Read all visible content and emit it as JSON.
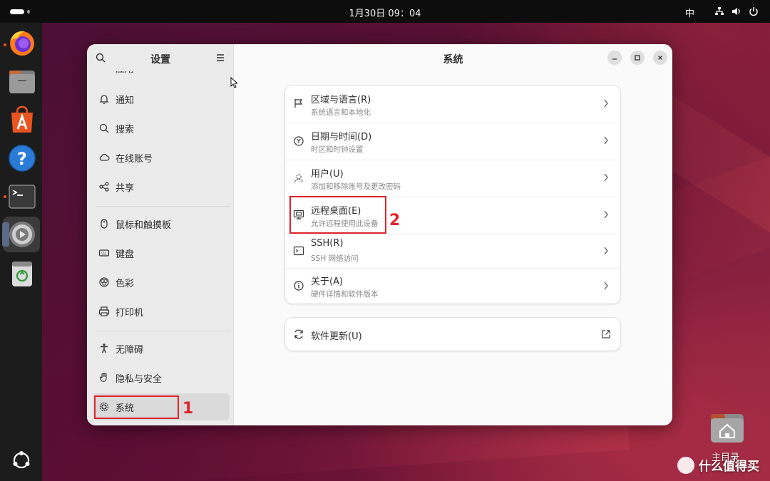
{
  "topbar": {
    "clock": "1月30日  09：04",
    "ime": "中"
  },
  "dock": {
    "items": [
      "firefox-icon",
      "files-icon",
      "app-center-icon",
      "help-icon",
      "terminal-icon",
      "settings-icon",
      "trash-icon"
    ],
    "bottom": "ubuntu-logo-icon"
  },
  "desktop": {
    "home_label": "主目录",
    "watermark": "什么值得买"
  },
  "sidebar": {
    "title": "设置",
    "partial_top": "应用",
    "items": [
      {
        "label": "通知",
        "icon": "bell-icon"
      },
      {
        "label": "搜索",
        "icon": "search-icon"
      },
      {
        "label": "在线账号",
        "icon": "cloud-icon"
      },
      {
        "label": "共享",
        "icon": "share-icon"
      },
      {
        "label": "鼠标和触摸板",
        "icon": "mouse-icon"
      },
      {
        "label": "键盘",
        "icon": "keyboard-icon"
      },
      {
        "label": "色彩",
        "icon": "color-icon"
      },
      {
        "label": "打印机",
        "icon": "printer-icon"
      },
      {
        "label": "无障碍",
        "icon": "accessibility-icon"
      },
      {
        "label": "隐私与安全",
        "icon": "hand-icon"
      },
      {
        "label": "系统",
        "icon": "system-gear-icon",
        "selected": true
      }
    ]
  },
  "main": {
    "title": "系统",
    "rows": [
      {
        "title": "区域与语言(R)",
        "subtitle": "系统语言和本地化",
        "icon": "flag-icon"
      },
      {
        "title": "日期与时间(D)",
        "subtitle": "时区和时钟设置",
        "icon": "clock-icon"
      },
      {
        "title": "用户(U)",
        "subtitle": "添加和移除账号及更改密码",
        "icon": "users-icon"
      },
      {
        "title": "远程桌面(E)",
        "subtitle": "允许远程使用此设备",
        "icon": "remote-desktop-icon"
      },
      {
        "title": "SSH(R)",
        "subtitle": "SSH 网络访问",
        "icon": "terminal-icon"
      },
      {
        "title": "关于(A)",
        "subtitle": "硬件详情和软件版本",
        "icon": "info-icon"
      }
    ],
    "update": {
      "title": "软件更新(U)",
      "icon": "refresh-icon"
    }
  },
  "annotations": {
    "step1": "1",
    "step2": "2",
    "color": "#e0242a"
  },
  "colors": {
    "accent": "#e95420",
    "topbar": "#0d0d0d",
    "dock": "#1c1c1c",
    "sidebar": "#ebebeb"
  }
}
